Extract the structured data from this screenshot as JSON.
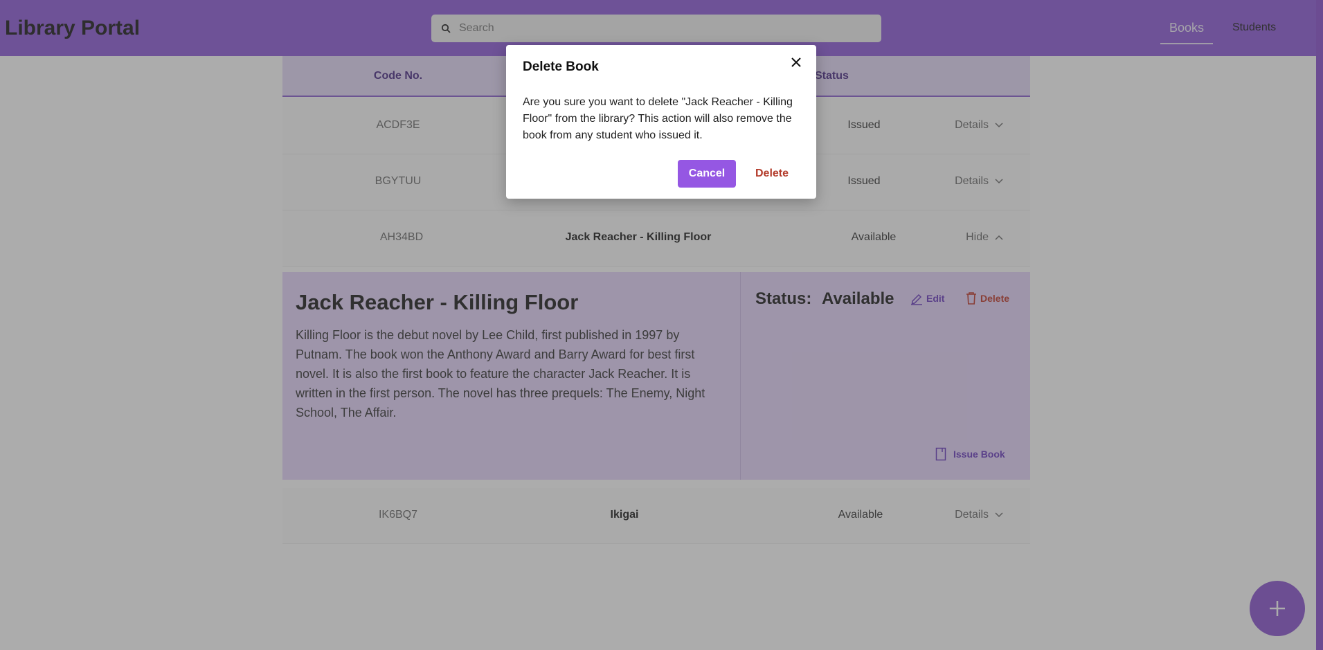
{
  "header": {
    "title": "Library Portal",
    "search_placeholder": "Search",
    "nav": {
      "books": "Books",
      "students": "Students"
    }
  },
  "table": {
    "headers": {
      "code": "Code No.",
      "status": "Status"
    },
    "rows": [
      {
        "code": "ACDF3E",
        "status": "Issued",
        "toggle": "Details"
      },
      {
        "code": "BGYTUU",
        "status": "Issued",
        "toggle": "Details"
      },
      {
        "code": "AH34BD",
        "title": "Jack Reacher - Killing Floor",
        "status": "Available",
        "toggle": "Hide"
      },
      {
        "code": "IK6BQ7",
        "title": "Ikigai",
        "status": "Available",
        "toggle": "Details"
      }
    ]
  },
  "detail": {
    "title": "Jack Reacher - Killing Floor",
    "description": "Killing Floor is the debut novel by Lee Child, first published in 1997 by Putnam. The book won the Anthony Award and Barry Award for best first novel. It is also the first book to feature the character Jack Reacher. It is written in the first person. The novel has three prequels: The Enemy, Night School, The Affair.",
    "status_label": "Status:",
    "status_value": "Available",
    "edit_label": "Edit",
    "delete_label": "Delete",
    "issue_label": "Issue Book"
  },
  "modal": {
    "title": "Delete Book",
    "body": "Are you sure you want to delete \"Jack Reacher - Killing Floor\" from the library? This action will also remove the book from any student who issued it.",
    "cancel_label": "Cancel",
    "delete_label": "Delete"
  },
  "colors": {
    "primary": "#8e5bd9",
    "danger": "#c0392b"
  }
}
